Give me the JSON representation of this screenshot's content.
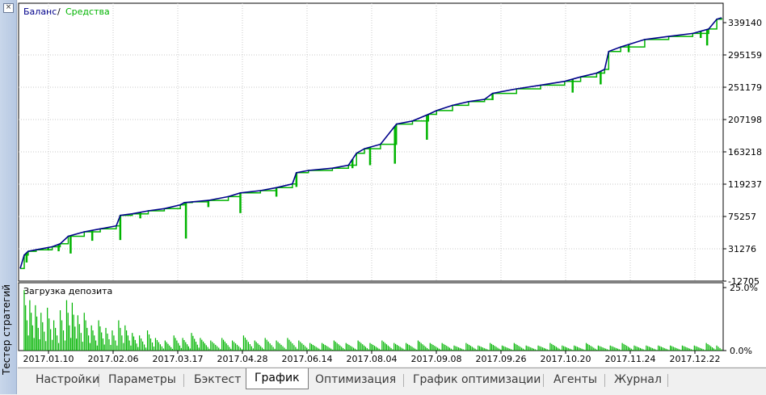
{
  "sidebar": {
    "title": "Тестер стратегий",
    "close_glyph": "×"
  },
  "main_chart": {
    "legend": {
      "balance": "Баланс",
      "separator": "/",
      "equity": "Средства"
    },
    "colors": {
      "balance": "#00008b",
      "equity": "#00b400",
      "grid": "#c8c8c8",
      "load": "#00b400"
    },
    "y_ticks": [
      "339140",
      "295159",
      "251179",
      "207198",
      "163218",
      "119237",
      "75257",
      "31276",
      "-12705"
    ],
    "ylim": [
      -12705,
      339140
    ]
  },
  "load_chart": {
    "title": "Загрузка депозита",
    "y_ticks": [
      "25.0%",
      "0.0%"
    ],
    "ylim": [
      0,
      25
    ]
  },
  "x_ticks": [
    "2017.01.10",
    "2017.02.06",
    "2017.03.17",
    "2017.04.28",
    "2017.06.14",
    "2017.08.04",
    "2017.09.08",
    "2017.09.26",
    "2017.10.20",
    "2017.11.24",
    "2017.12.22"
  ],
  "tabs": [
    {
      "label": "Настройки",
      "active": false
    },
    {
      "label": "Параметры",
      "active": false
    },
    {
      "label": "Бэктест",
      "active": false
    },
    {
      "label": "График",
      "active": true
    },
    {
      "label": "Оптимизация",
      "active": false
    },
    {
      "label": "График оптимизации",
      "active": false
    },
    {
      "label": "Агенты",
      "active": false
    },
    {
      "label": "Журнал",
      "active": false
    }
  ],
  "chart_data": {
    "type": "line",
    "ylim": [
      -12705,
      339140
    ],
    "series": [
      {
        "name": "Баланс",
        "points": [
          [
            0,
            2000
          ],
          [
            5,
            20000
          ],
          [
            10,
            25000
          ],
          [
            20,
            27000
          ],
          [
            40,
            31000
          ],
          [
            50,
            35000
          ],
          [
            60,
            45000
          ],
          [
            80,
            51000
          ],
          [
            100,
            55000
          ],
          [
            120,
            59000
          ],
          [
            125,
            73000
          ],
          [
            140,
            75000
          ],
          [
            160,
            79000
          ],
          [
            180,
            82000
          ],
          [
            200,
            87000
          ],
          [
            205,
            90000
          ],
          [
            215,
            91000
          ],
          [
            235,
            93000
          ],
          [
            260,
            98000
          ],
          [
            275,
            103000
          ],
          [
            300,
            106000
          ],
          [
            320,
            110000
          ],
          [
            340,
            115000
          ],
          [
            345,
            130000
          ],
          [
            360,
            133000
          ],
          [
            390,
            136000
          ],
          [
            410,
            140000
          ],
          [
            420,
            156000
          ],
          [
            430,
            162000
          ],
          [
            450,
            168000
          ],
          [
            470,
            195000
          ],
          [
            490,
            199000
          ],
          [
            510,
            208000
          ],
          [
            520,
            213000
          ],
          [
            540,
            220000
          ],
          [
            560,
            225000
          ],
          [
            580,
            228000
          ],
          [
            590,
            236000
          ],
          [
            620,
            242000
          ],
          [
            650,
            247000
          ],
          [
            680,
            252000
          ],
          [
            700,
            258000
          ],
          [
            720,
            263000
          ],
          [
            730,
            268000
          ],
          [
            735,
            292000
          ],
          [
            750,
            298000
          ],
          [
            780,
            308000
          ],
          [
            810,
            312000
          ],
          [
            840,
            316000
          ],
          [
            860,
            322000
          ],
          [
            870,
            335000
          ],
          [
            876,
            337000
          ]
        ]
      },
      {
        "name": "Средства",
        "dips": [
          [
            8,
            10000
          ],
          [
            35,
            27000
          ],
          [
            48,
            25000
          ],
          [
            63,
            22000
          ],
          [
            90,
            39000
          ],
          [
            125,
            40000
          ],
          [
            150,
            69000
          ],
          [
            207,
            42000
          ],
          [
            235,
            84000
          ],
          [
            275,
            76000
          ],
          [
            320,
            98000
          ],
          [
            345,
            111000
          ],
          [
            415,
            136000
          ],
          [
            437,
            140000
          ],
          [
            468,
            142000
          ],
          [
            508,
            174000
          ],
          [
            590,
            227000
          ],
          [
            690,
            237000
          ],
          [
            725,
            248000
          ],
          [
            760,
            291000
          ],
          [
            850,
            310000
          ],
          [
            858,
            300000
          ]
        ]
      }
    ],
    "deposit_load": {
      "unit": "%",
      "ylim": [
        0,
        25
      ],
      "values": [
        [
          5,
          24
        ],
        [
          12,
          20
        ],
        [
          19,
          18
        ],
        [
          26,
          15
        ],
        [
          34,
          17
        ],
        [
          42,
          12
        ],
        [
          50,
          16
        ],
        [
          58,
          20
        ],
        [
          65,
          19
        ],
        [
          72,
          14
        ],
        [
          80,
          15
        ],
        [
          89,
          10
        ],
        [
          98,
          12
        ],
        [
          107,
          9
        ],
        [
          115,
          8
        ],
        [
          123,
          12
        ],
        [
          131,
          10
        ],
        [
          140,
          7
        ],
        [
          149,
          6
        ],
        [
          159,
          8
        ],
        [
          169,
          5
        ],
        [
          181,
          4
        ],
        [
          192,
          6
        ],
        [
          203,
          5
        ],
        [
          214,
          7
        ],
        [
          225,
          5
        ],
        [
          238,
          4
        ],
        [
          252,
          5
        ],
        [
          265,
          4
        ],
        [
          279,
          6
        ],
        [
          293,
          4
        ],
        [
          306,
          5
        ],
        [
          320,
          4
        ],
        [
          334,
          5
        ],
        [
          348,
          4
        ],
        [
          362,
          3
        ],
        [
          377,
          3
        ],
        [
          392,
          4
        ],
        [
          407,
          3
        ],
        [
          422,
          4
        ],
        [
          437,
          3
        ],
        [
          452,
          4
        ],
        [
          467,
          3
        ],
        [
          482,
          3
        ],
        [
          497,
          4
        ],
        [
          512,
          3
        ],
        [
          527,
          3
        ],
        [
          542,
          2
        ],
        [
          557,
          3
        ],
        [
          572,
          2
        ],
        [
          587,
          3
        ],
        [
          602,
          2
        ],
        [
          617,
          3
        ],
        [
          632,
          2
        ],
        [
          647,
          2
        ],
        [
          662,
          3
        ],
        [
          677,
          2
        ],
        [
          692,
          2
        ],
        [
          707,
          3
        ],
        [
          722,
          2
        ],
        [
          737,
          2
        ],
        [
          752,
          3
        ],
        [
          767,
          2
        ],
        [
          782,
          2
        ],
        [
          797,
          2
        ],
        [
          812,
          2
        ],
        [
          827,
          2
        ],
        [
          842,
          2
        ],
        [
          857,
          3
        ],
        [
          870,
          2
        ]
      ]
    }
  }
}
